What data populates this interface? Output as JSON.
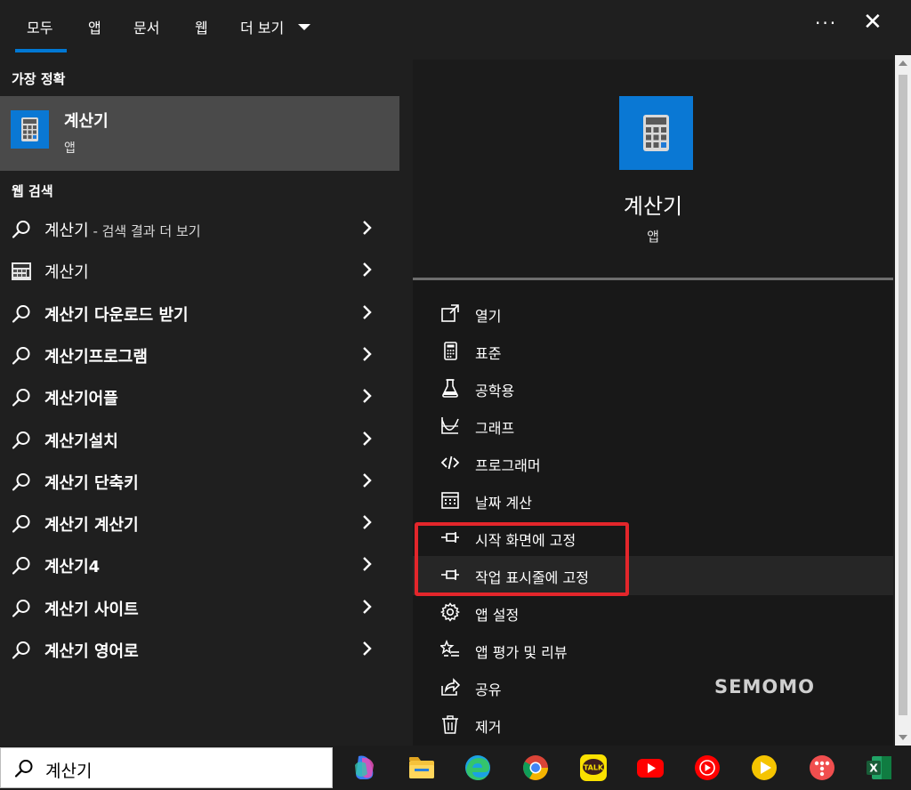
{
  "tabs": [
    "모두",
    "앱",
    "문서",
    "웹",
    "더 보기"
  ],
  "best_match": {
    "section_title": "가장 정확",
    "name": "계산기",
    "type": "앱"
  },
  "web_search": {
    "section_title": "웹 검색",
    "items": [
      {
        "icon": "search-icon",
        "text": "계산기",
        "suffix": " - 검색 결과 더 보기",
        "bold": false
      },
      {
        "icon": "calculator-thumb-icon",
        "text": "계산기",
        "suffix": "",
        "bold": false
      },
      {
        "icon": "search-icon",
        "text": "계산기 다운로드 받기",
        "suffix": "",
        "bold": true
      },
      {
        "icon": "search-icon",
        "text": "계산기프로그램",
        "suffix": "",
        "bold": true
      },
      {
        "icon": "search-icon",
        "text": "계산기어플",
        "suffix": "",
        "bold": true
      },
      {
        "icon": "search-icon",
        "text": "계산기설치",
        "suffix": "",
        "bold": true
      },
      {
        "icon": "search-icon",
        "text": "계산기 단축키",
        "suffix": "",
        "bold": true
      },
      {
        "icon": "search-icon",
        "text": "계산기 계산기",
        "suffix": "",
        "bold": true
      },
      {
        "icon": "search-icon",
        "text": "계산기4",
        "suffix": "",
        "bold": true
      },
      {
        "icon": "search-icon",
        "text": "계산기 사이트",
        "suffix": "",
        "bold": true
      },
      {
        "icon": "search-icon",
        "text": "계산기 영어로",
        "suffix": "",
        "bold": true
      }
    ]
  },
  "detail": {
    "name": "계산기",
    "type": "앱",
    "actions": [
      {
        "icon": "open-icon",
        "label": "열기"
      },
      {
        "icon": "calculator-standard-icon",
        "label": "표준"
      },
      {
        "icon": "flask-icon",
        "label": "공학용"
      },
      {
        "icon": "graph-icon",
        "label": "그래프"
      },
      {
        "icon": "code-icon",
        "label": "프로그래머"
      },
      {
        "icon": "calendar-icon",
        "label": "날짜 계산"
      },
      {
        "icon": "pin-icon",
        "label": "시작 화면에 고정"
      },
      {
        "icon": "pin-icon",
        "label": "작업 표시줄에 고정"
      },
      {
        "icon": "gear-icon",
        "label": "앱 설정"
      },
      {
        "icon": "star-list-icon",
        "label": "앱 평가 및 리뷰"
      },
      {
        "icon": "share-icon",
        "label": "공유"
      },
      {
        "icon": "trash-icon",
        "label": "제거"
      }
    ]
  },
  "watermark": "SEMOMO",
  "taskbar": {
    "search_value": "계산기",
    "apps": [
      "copilot-icon",
      "file-explorer-icon",
      "edge-icon",
      "chrome-icon",
      "kakaotalk-icon",
      "youtube-icon",
      "youtube-music-icon",
      "media-player-icon",
      "t-icon",
      "excel-icon"
    ]
  },
  "colors": {
    "accent": "#0078d4",
    "highlight_box": "#e3262b",
    "selected_bg": "#4a4a4a"
  }
}
